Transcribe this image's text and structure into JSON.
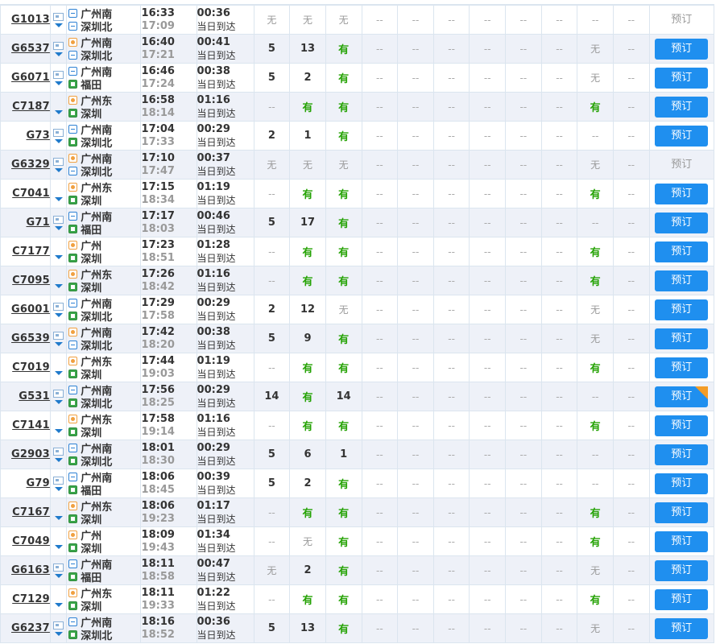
{
  "book_label": "预订",
  "rows": [
    {
      "no": "G1013",
      "card": true,
      "from_badge": "guo",
      "from": "广州南",
      "to_badge": "guo",
      "to": "深圳北",
      "dep": "16:33",
      "arr": "17:09",
      "dur": "00:36",
      "note": "当日到达",
      "seats": [
        "无",
        "无",
        "无",
        "--",
        "--",
        "--",
        "--",
        "--",
        "--",
        "--",
        "--"
      ],
      "bookable": false,
      "hot": false
    },
    {
      "no": "G6537",
      "card": true,
      "from_badge": "shi",
      "from": "广州南",
      "to_badge": "guo",
      "to": "深圳北",
      "dep": "16:40",
      "arr": "17:21",
      "dur": "00:41",
      "note": "当日到达",
      "seats": [
        "5",
        "13",
        "有",
        "--",
        "--",
        "--",
        "--",
        "--",
        "--",
        "无",
        "--"
      ],
      "bookable": true,
      "hot": false
    },
    {
      "no": "G6071",
      "card": true,
      "from_badge": "guo",
      "from": "广州南",
      "to_badge": "zhong",
      "to": "福田",
      "dep": "16:46",
      "arr": "17:24",
      "dur": "00:38",
      "note": "当日到达",
      "seats": [
        "5",
        "2",
        "有",
        "--",
        "--",
        "--",
        "--",
        "--",
        "--",
        "无",
        "--"
      ],
      "bookable": true,
      "hot": false
    },
    {
      "no": "C7187",
      "card": false,
      "from_badge": "shi",
      "from": "广州东",
      "to_badge": "zhong",
      "to": "深圳",
      "dep": "16:58",
      "arr": "18:14",
      "dur": "01:16",
      "note": "当日到达",
      "seats": [
        "--",
        "有",
        "有",
        "--",
        "--",
        "--",
        "--",
        "--",
        "--",
        "有",
        "--"
      ],
      "bookable": true,
      "hot": false
    },
    {
      "no": "G73",
      "card": true,
      "from_badge": "guo",
      "from": "广州南",
      "to_badge": "zhong",
      "to": "深圳北",
      "dep": "17:04",
      "arr": "17:33",
      "dur": "00:29",
      "note": "当日到达",
      "seats": [
        "2",
        "1",
        "有",
        "--",
        "--",
        "--",
        "--",
        "--",
        "--",
        "--",
        "--"
      ],
      "bookable": true,
      "hot": false
    },
    {
      "no": "G6329",
      "card": true,
      "from_badge": "shi",
      "from": "广州南",
      "to_badge": "guo",
      "to": "深圳北",
      "dep": "17:10",
      "arr": "17:47",
      "dur": "00:37",
      "note": "当日到达",
      "seats": [
        "无",
        "无",
        "无",
        "--",
        "--",
        "--",
        "--",
        "--",
        "--",
        "无",
        "--"
      ],
      "bookable": false,
      "hot": false
    },
    {
      "no": "C7041",
      "card": false,
      "from_badge": "shi",
      "from": "广州东",
      "to_badge": "zhong",
      "to": "深圳",
      "dep": "17:15",
      "arr": "18:34",
      "dur": "01:19",
      "note": "当日到达",
      "seats": [
        "--",
        "有",
        "有",
        "--",
        "--",
        "--",
        "--",
        "--",
        "--",
        "有",
        "--"
      ],
      "bookable": true,
      "hot": false
    },
    {
      "no": "G71",
      "card": true,
      "from_badge": "guo",
      "from": "广州南",
      "to_badge": "zhong",
      "to": "福田",
      "dep": "17:17",
      "arr": "18:03",
      "dur": "00:46",
      "note": "当日到达",
      "seats": [
        "5",
        "17",
        "有",
        "--",
        "--",
        "--",
        "--",
        "--",
        "--",
        "--",
        "--"
      ],
      "bookable": true,
      "hot": false
    },
    {
      "no": "C7177",
      "card": false,
      "from_badge": "shi",
      "from": "广州",
      "to_badge": "zhong",
      "to": "深圳",
      "dep": "17:23",
      "arr": "18:51",
      "dur": "01:28",
      "note": "当日到达",
      "seats": [
        "--",
        "有",
        "有",
        "--",
        "--",
        "--",
        "--",
        "--",
        "--",
        "有",
        "--"
      ],
      "bookable": true,
      "hot": false
    },
    {
      "no": "C7095",
      "card": false,
      "from_badge": "shi",
      "from": "广州东",
      "to_badge": "zhong",
      "to": "深圳",
      "dep": "17:26",
      "arr": "18:42",
      "dur": "01:16",
      "note": "当日到达",
      "seats": [
        "--",
        "有",
        "有",
        "--",
        "--",
        "--",
        "--",
        "--",
        "--",
        "有",
        "--"
      ],
      "bookable": true,
      "hot": false
    },
    {
      "no": "G6001",
      "card": true,
      "from_badge": "guo",
      "from": "广州南",
      "to_badge": "zhong",
      "to": "深圳北",
      "dep": "17:29",
      "arr": "17:58",
      "dur": "00:29",
      "note": "当日到达",
      "seats": [
        "2",
        "12",
        "无",
        "--",
        "--",
        "--",
        "--",
        "--",
        "--",
        "无",
        "--"
      ],
      "bookable": true,
      "hot": false
    },
    {
      "no": "G6539",
      "card": true,
      "from_badge": "shi",
      "from": "广州南",
      "to_badge": "guo",
      "to": "深圳北",
      "dep": "17:42",
      "arr": "18:20",
      "dur": "00:38",
      "note": "当日到达",
      "seats": [
        "5",
        "9",
        "有",
        "--",
        "--",
        "--",
        "--",
        "--",
        "--",
        "无",
        "--"
      ],
      "bookable": true,
      "hot": false
    },
    {
      "no": "C7019",
      "card": false,
      "from_badge": "shi",
      "from": "广州东",
      "to_badge": "zhong",
      "to": "深圳",
      "dep": "17:44",
      "arr": "19:03",
      "dur": "01:19",
      "note": "当日到达",
      "seats": [
        "--",
        "有",
        "有",
        "--",
        "--",
        "--",
        "--",
        "--",
        "--",
        "有",
        "--"
      ],
      "bookable": true,
      "hot": false
    },
    {
      "no": "G531",
      "card": true,
      "from_badge": "guo",
      "from": "广州南",
      "to_badge": "zhong",
      "to": "深圳北",
      "dep": "17:56",
      "arr": "18:25",
      "dur": "00:29",
      "note": "当日到达",
      "seats": [
        "14",
        "有",
        "14",
        "--",
        "--",
        "--",
        "--",
        "--",
        "--",
        "--",
        "--"
      ],
      "bookable": true,
      "hot": true
    },
    {
      "no": "C7141",
      "card": false,
      "from_badge": "shi",
      "from": "广州东",
      "to_badge": "zhong",
      "to": "深圳",
      "dep": "17:58",
      "arr": "19:14",
      "dur": "01:16",
      "note": "当日到达",
      "seats": [
        "--",
        "有",
        "有",
        "--",
        "--",
        "--",
        "--",
        "--",
        "--",
        "有",
        "--"
      ],
      "bookable": true,
      "hot": false
    },
    {
      "no": "G2903",
      "card": true,
      "from_badge": "guo",
      "from": "广州南",
      "to_badge": "zhong",
      "to": "深圳北",
      "dep": "18:01",
      "arr": "18:30",
      "dur": "00:29",
      "note": "当日到达",
      "seats": [
        "5",
        "6",
        "1",
        "--",
        "--",
        "--",
        "--",
        "--",
        "--",
        "--",
        "--"
      ],
      "bookable": true,
      "hot": false
    },
    {
      "no": "G79",
      "card": true,
      "from_badge": "guo",
      "from": "广州南",
      "to_badge": "zhong",
      "to": "福田",
      "dep": "18:06",
      "arr": "18:45",
      "dur": "00:39",
      "note": "当日到达",
      "seats": [
        "5",
        "2",
        "有",
        "--",
        "--",
        "--",
        "--",
        "--",
        "--",
        "--",
        "--"
      ],
      "bookable": true,
      "hot": false
    },
    {
      "no": "C7167",
      "card": false,
      "from_badge": "shi",
      "from": "广州东",
      "to_badge": "zhong",
      "to": "深圳",
      "dep": "18:06",
      "arr": "19:23",
      "dur": "01:17",
      "note": "当日到达",
      "seats": [
        "--",
        "有",
        "有",
        "--",
        "--",
        "--",
        "--",
        "--",
        "--",
        "有",
        "--"
      ],
      "bookable": true,
      "hot": false
    },
    {
      "no": "C7049",
      "card": false,
      "from_badge": "shi",
      "from": "广州",
      "to_badge": "zhong",
      "to": "深圳",
      "dep": "18:09",
      "arr": "19:43",
      "dur": "01:34",
      "note": "当日到达",
      "seats": [
        "--",
        "无",
        "有",
        "--",
        "--",
        "--",
        "--",
        "--",
        "--",
        "有",
        "--"
      ],
      "bookable": true,
      "hot": false
    },
    {
      "no": "G6163",
      "card": true,
      "from_badge": "guo",
      "from": "广州南",
      "to_badge": "zhong",
      "to": "福田",
      "dep": "18:11",
      "arr": "18:58",
      "dur": "00:47",
      "note": "当日到达",
      "seats": [
        "无",
        "2",
        "有",
        "--",
        "--",
        "--",
        "--",
        "--",
        "--",
        "无",
        "--"
      ],
      "bookable": true,
      "hot": false
    },
    {
      "no": "C7129",
      "card": false,
      "from_badge": "shi",
      "from": "广州东",
      "to_badge": "zhong",
      "to": "深圳",
      "dep": "18:11",
      "arr": "19:33",
      "dur": "01:22",
      "note": "当日到达",
      "seats": [
        "--",
        "有",
        "有",
        "--",
        "--",
        "--",
        "--",
        "--",
        "--",
        "有",
        "--"
      ],
      "bookable": true,
      "hot": false
    },
    {
      "no": "G6237",
      "card": true,
      "from_badge": "guo",
      "from": "广州南",
      "to_badge": "zhong",
      "to": "深圳北",
      "dep": "18:16",
      "arr": "18:52",
      "dur": "00:36",
      "note": "当日到达",
      "seats": [
        "5",
        "13",
        "有",
        "--",
        "--",
        "--",
        "--",
        "--",
        "--",
        "无",
        "--"
      ],
      "bookable": true,
      "hot": false
    }
  ]
}
